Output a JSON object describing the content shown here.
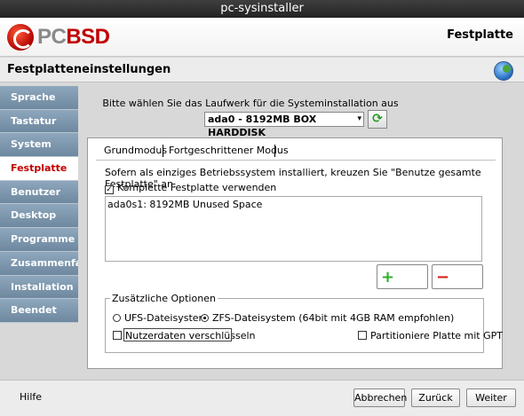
{
  "window": {
    "title": "pc-sysinstaller"
  },
  "header": {
    "logo_pc": "PC",
    "logo_bsd": "BSD",
    "section_title": "Festplatte"
  },
  "subheader": {
    "title": "Festplatteneinstellungen"
  },
  "sidebar": {
    "items": [
      {
        "label": "Sprache"
      },
      {
        "label": "Tastatur"
      },
      {
        "label": "System"
      },
      {
        "label": "Festplatte",
        "active": true
      },
      {
        "label": "Benutzer"
      },
      {
        "label": "Desktop"
      },
      {
        "label": "Programme"
      },
      {
        "label": "Zusammenfas"
      },
      {
        "label": "Installation"
      },
      {
        "label": "Beendet"
      }
    ]
  },
  "disk": {
    "prompt": "Bitte wählen Sie das Laufwerk für die Systeminstallation aus",
    "selected_drive": "ada0 - 8192MB BOX HARDDISK"
  },
  "tabs": [
    {
      "label": "Grundmodus"
    },
    {
      "label": "Fortgeschrittener Modus"
    }
  ],
  "basic": {
    "hint": "Sofern als einziges Betriebssystem installiert, kreuzen Sie \"Benutze gesamte Festplatte\" an.",
    "use_whole_disk_label": "Komplette Festplatte verwenden",
    "use_whole_disk_checked": true,
    "partitions": [
      "ada0s1: 8192MB Unused Space"
    ]
  },
  "options": {
    "legend": "Zusätzliche Optionen",
    "ufs_label": "UFS-Dateisystem",
    "zfs_label": "ZFS-Dateisystem (64bit mit 4GB RAM empfohlen)",
    "selected_fs": "zfs",
    "encrypt_label": "Nutzerdaten verschlüsseln",
    "gpt_label": "Partitioniere Platte mit GPT"
  },
  "footer": {
    "help": "Hilfe",
    "cancel": "Abbrechen",
    "back": "Zurück",
    "next": "Weiter"
  },
  "colors": {
    "brand_red": "#c00000",
    "sidebar_blue": "#7890a8"
  }
}
